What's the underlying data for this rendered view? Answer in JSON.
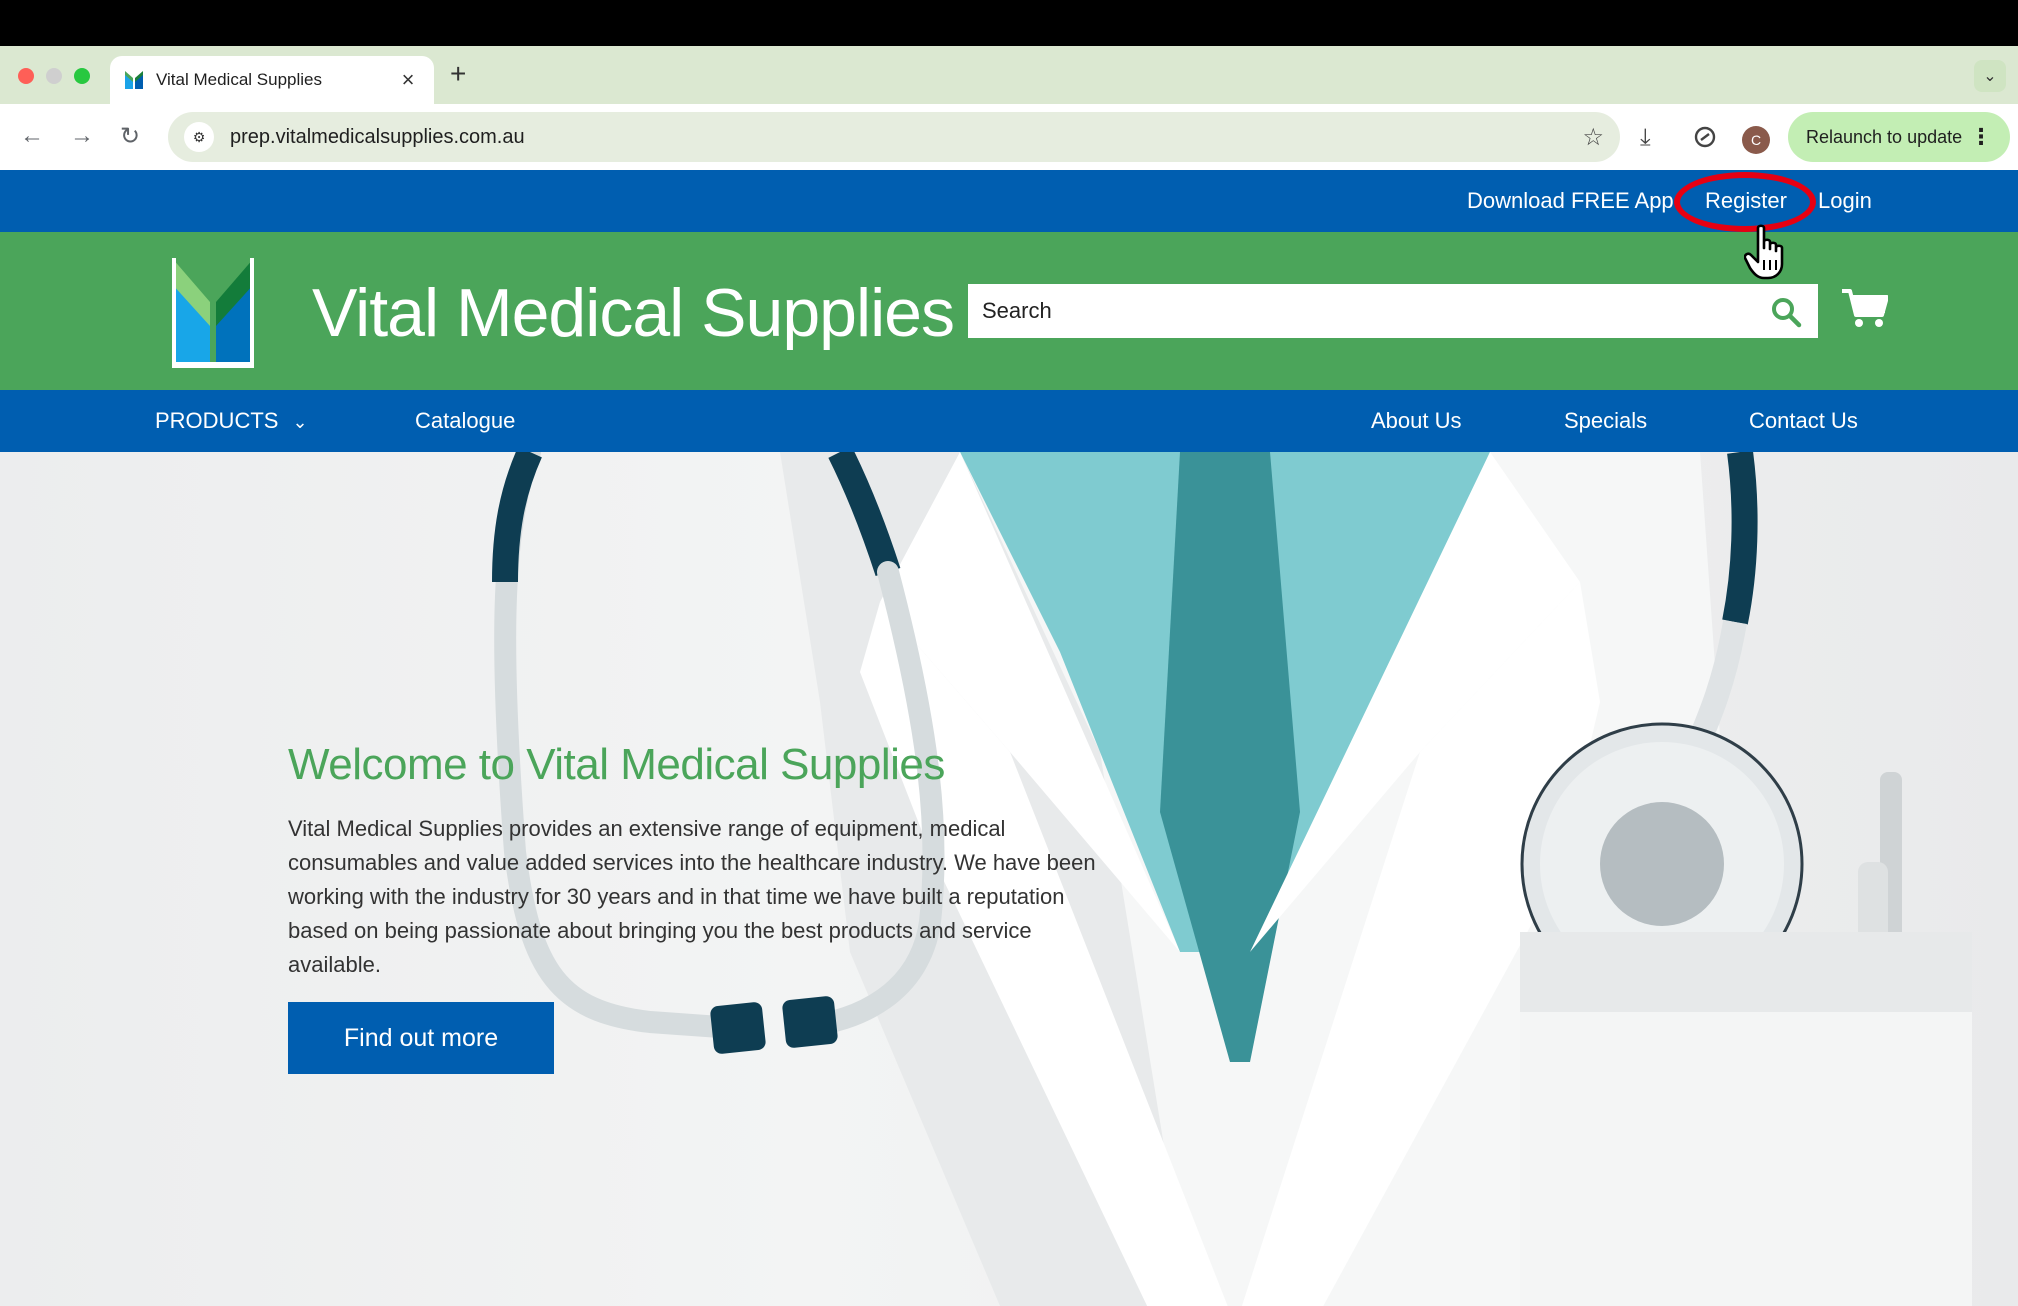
{
  "browser": {
    "tab_title": "Vital Medical Supplies",
    "tab_close": "×",
    "new_tab": "+",
    "tabs_menu": "⌄",
    "url": "prep.vitalmedicalsupplies.com.au",
    "avatar_letter": "C",
    "relaunch_label": "Relaunch to update",
    "relaunch_menu": "⋮",
    "nav": {
      "back": "←",
      "forward": "→",
      "reload": "↻",
      "star": "☆",
      "download": "⤓"
    }
  },
  "utility_bar": {
    "download_app": "Download FREE App",
    "register": "Register",
    "login": "Login"
  },
  "header": {
    "brand_name": "Vital Medical Supplies",
    "search_placeholder": "Search"
  },
  "main_nav": {
    "products": "PRODUCTS",
    "products_chevron": "⌄",
    "catalogue": "Catalogue",
    "about": "About Us",
    "specials": "Specials",
    "contact": "Contact Us"
  },
  "hero": {
    "title": "Welcome to Vital Medical Supplies",
    "body": "Vital Medical Supplies provides an extensive range of equipment, medical consumables and value added services into the healthcare industry. We have been working with the industry for 30 years and in that time we have built a reputation based on being passionate about bringing you the best products and service available.",
    "cta_label": "Find out more"
  },
  "colors": {
    "brand_blue": "#005eb0",
    "brand_green": "#4ba55a",
    "highlight_ring": "#e60012"
  }
}
